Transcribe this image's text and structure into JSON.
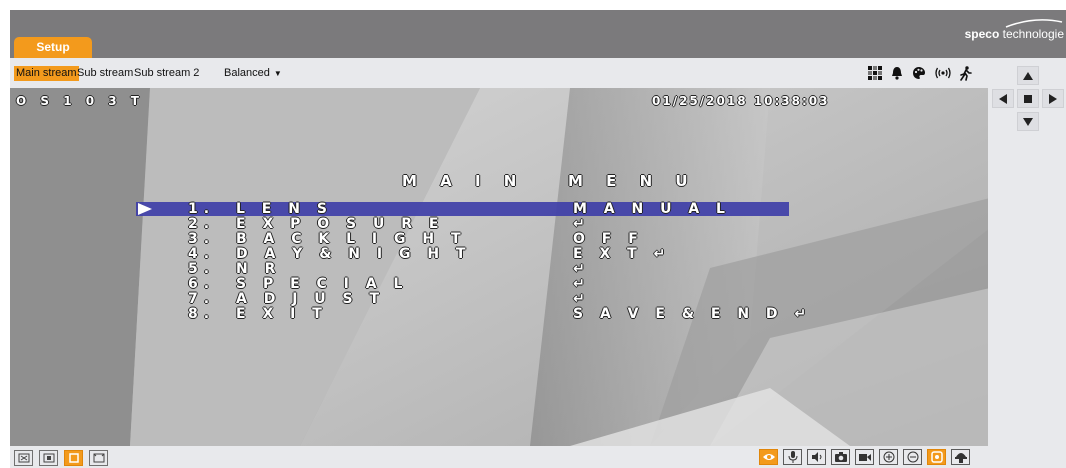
{
  "header": {
    "setup_tab": "Setup",
    "brand_bold": "speco",
    "brand_rest": " technologie"
  },
  "toolbar": {
    "streams": [
      {
        "label": "Main stream",
        "active": true
      },
      {
        "label": "Sub stream",
        "active": false
      },
      {
        "label": "Sub stream 2",
        "active": false
      }
    ],
    "quality_select": "Balanced"
  },
  "osd": {
    "camera_id": "O S 1 0 3 T",
    "datetime": "01/25/2018 10:38:03",
    "menu_title": "M A I N   M E N U",
    "items": [
      {
        "num": "1.",
        "label": "L E N S",
        "value": "M A N U A L",
        "selected": true
      },
      {
        "num": "2.",
        "label": "E X P O S U R E",
        "value": "↵",
        "selected": false
      },
      {
        "num": "3.",
        "label": "B A C K L I G H T",
        "value": "O F F",
        "selected": false
      },
      {
        "num": "4.",
        "label": "D A Y & N I G H T",
        "value": "E X T ↵",
        "selected": false
      },
      {
        "num": "5.",
        "label": "N R",
        "value": "↵",
        "selected": false
      },
      {
        "num": "6.",
        "label": "S P E C I A L",
        "value": "↵",
        "selected": false
      },
      {
        "num": "7.",
        "label": "A D J U S T",
        "value": "↵",
        "selected": false
      },
      {
        "num": "8.",
        "label": "E X I T",
        "value": "S A V E & E N D ↵",
        "selected": false
      }
    ]
  },
  "icons": {
    "toolbar": [
      "mosaic-icon",
      "bell-icon",
      "palette-icon",
      "wireless-signal-icon",
      "running-person-icon"
    ],
    "ptz": [
      "arrow-up-icon",
      "arrow-left-icon",
      "stop-icon",
      "arrow-right-icon",
      "arrow-down-icon"
    ],
    "bottom_left": [
      "fit-window-icon",
      "original-size-icon",
      "window-mode-icon",
      "fullscreen-icon"
    ],
    "bottom_right": [
      "eye-icon",
      "microphone-icon",
      "speaker-icon",
      "snapshot-icon",
      "record-icon",
      "zoom-in-icon",
      "zoom-out-icon",
      "ptz-control-icon",
      "dome-camera-icon"
    ]
  },
  "colors": {
    "accent": "#f39a1c",
    "header_bg": "#7b7a7c",
    "toolbar_bg": "#e8e9ec",
    "osd_highlight": "#3f3fa8"
  }
}
